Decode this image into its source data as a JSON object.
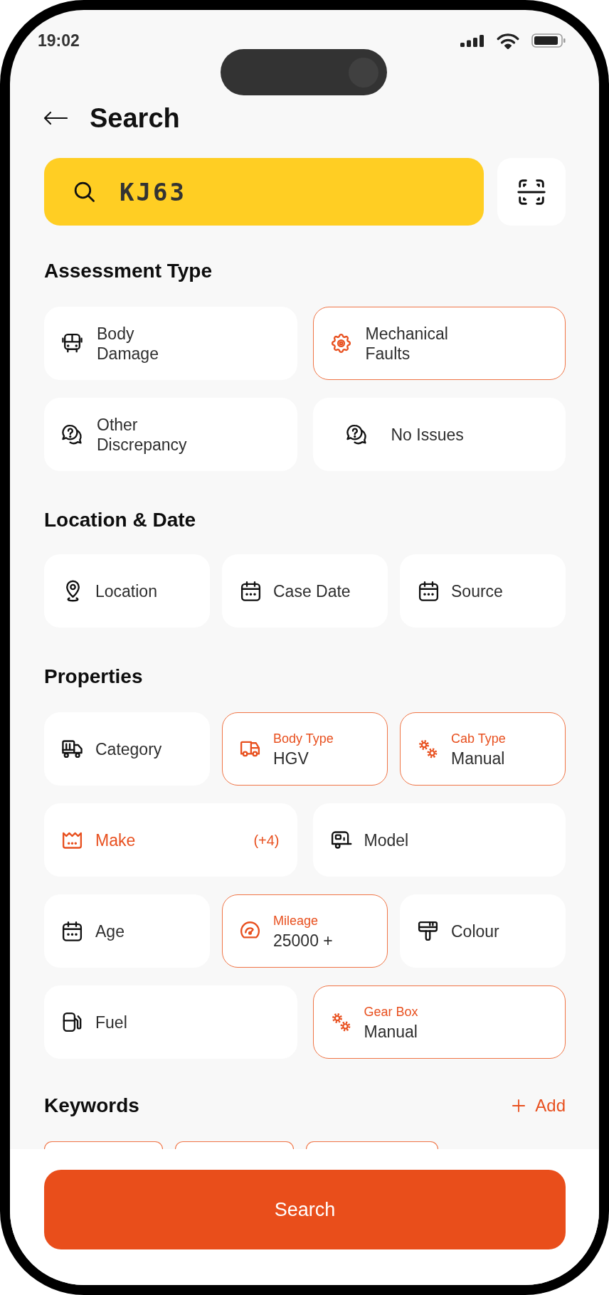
{
  "status_bar": {
    "time": "19:02"
  },
  "header": {
    "title": "Search"
  },
  "search": {
    "value": "KJ63"
  },
  "assessment_type": {
    "title": "Assessment Type",
    "options": [
      {
        "label": "Body\nDamage",
        "selected": false
      },
      {
        "label": "Mechanical\nFaults",
        "selected": true
      },
      {
        "label": "Other\nDiscrepancy",
        "selected": false
      },
      {
        "label": "No Issues",
        "selected": false
      }
    ]
  },
  "location_date": {
    "title": "Location & Date",
    "fields": [
      {
        "label": "Location"
      },
      {
        "label": "Case Date"
      },
      {
        "label": "Source"
      }
    ]
  },
  "properties": {
    "title": "Properties",
    "rows": [
      [
        {
          "label": "Category",
          "selected": false,
          "active": false
        },
        {
          "label": "Body Type",
          "value": "HGV",
          "selected": true,
          "active": true
        },
        {
          "label": "Cab Type",
          "value": "Manual",
          "selected": true,
          "active": true
        }
      ],
      [
        {
          "label": "Make",
          "count": "(+4)",
          "selected": false,
          "active": true
        },
        {
          "label": "Model",
          "selected": false,
          "active": false
        }
      ],
      [
        {
          "label": "Age",
          "selected": false,
          "active": false
        },
        {
          "label": "Mileage",
          "value": "25000 +",
          "selected": true,
          "active": true
        },
        {
          "label": "Colour",
          "selected": false,
          "active": false
        }
      ],
      [
        {
          "label": "Fuel",
          "selected": false,
          "active": false
        },
        {
          "label": "Gear Box",
          "value": "Manual",
          "selected": true,
          "active": true
        }
      ]
    ]
  },
  "keywords": {
    "title": "Keywords",
    "add_label": "Add",
    "chips": [
      {
        "selected": true
      },
      {
        "selected": true
      },
      {
        "selected": true
      }
    ]
  },
  "search_button": {
    "label": "Search"
  }
}
